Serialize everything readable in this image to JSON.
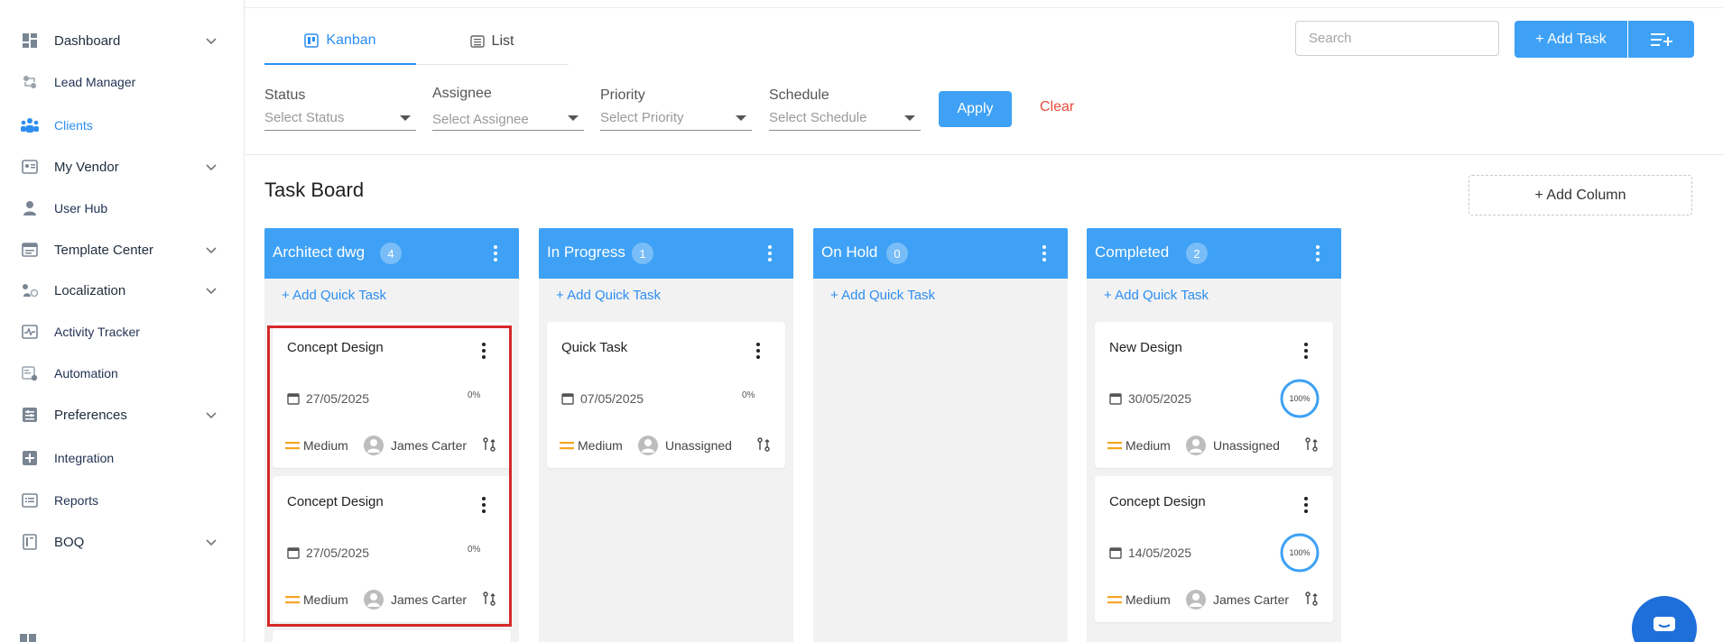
{
  "sidebar": {
    "items": [
      {
        "label": "Dashboard",
        "icon": "dashboard-icon"
      },
      {
        "label": "Lead Manager",
        "icon": "lead-icon"
      },
      {
        "label": "Clients",
        "icon": "clients-icon"
      },
      {
        "label": "My Vendor",
        "icon": "vendor-icon"
      },
      {
        "label": "User Hub",
        "icon": "user-icon"
      },
      {
        "label": "Template Center",
        "icon": "template-icon"
      },
      {
        "label": "Localization",
        "icon": "localization-icon"
      },
      {
        "label": "Activity Tracker",
        "icon": "activity-icon"
      },
      {
        "label": "Automation",
        "icon": "automation-icon"
      },
      {
        "label": "Preferences",
        "icon": "preferences-icon"
      },
      {
        "label": "Integration",
        "icon": "integration-icon"
      },
      {
        "label": "Reports",
        "icon": "reports-icon"
      },
      {
        "label": "BOQ",
        "icon": "boq-icon"
      }
    ]
  },
  "tabs": {
    "kanban": "Kanban",
    "list": "List"
  },
  "search": {
    "placeholder": "Search"
  },
  "toolbar": {
    "add_task": "+ Add Task"
  },
  "filters": {
    "status": {
      "label": "Status",
      "value": "Select Status"
    },
    "assignee": {
      "label": "Assignee",
      "value": "Select Assignee"
    },
    "priority": {
      "label": "Priority",
      "value": "Select Priority"
    },
    "schedule": {
      "label": "Schedule",
      "value": "Select Schedule"
    },
    "apply": "Apply",
    "clear": "Clear"
  },
  "board": {
    "title": "Task Board",
    "add_column": "+ Add Column",
    "quick_add": "+ Add Quick Task",
    "columns": [
      {
        "name": "Architect dwg",
        "count": "4",
        "cards": [
          {
            "title": "Concept Design",
            "date": "27/05/2025",
            "progress": "0%",
            "priority": "Medium",
            "assignee": "James Carter"
          },
          {
            "title": "Concept Design",
            "date": "27/05/2025",
            "progress": "0%",
            "priority": "Medium",
            "assignee": "James Carter"
          }
        ]
      },
      {
        "name": "In Progress",
        "count": "1",
        "cards": [
          {
            "title": "Quick Task",
            "date": "07/05/2025",
            "progress": "0%",
            "priority": "Medium",
            "assignee": "Unassigned"
          }
        ]
      },
      {
        "name": "On Hold",
        "count": "0",
        "cards": []
      },
      {
        "name": "Completed",
        "count": "2",
        "cards": [
          {
            "title": "New Design",
            "date": "30/05/2025",
            "progress": "100%",
            "priority": "Medium",
            "assignee": "Unassigned"
          },
          {
            "title": "Concept Design",
            "date": "14/05/2025",
            "progress": "100%",
            "priority": "Medium",
            "assignee": "James Carter"
          }
        ]
      }
    ]
  },
  "colors": {
    "accent": "#3ea1f5",
    "clear": "#e74c3c",
    "highlight": "#d62828",
    "priority": "#f5a623"
  }
}
